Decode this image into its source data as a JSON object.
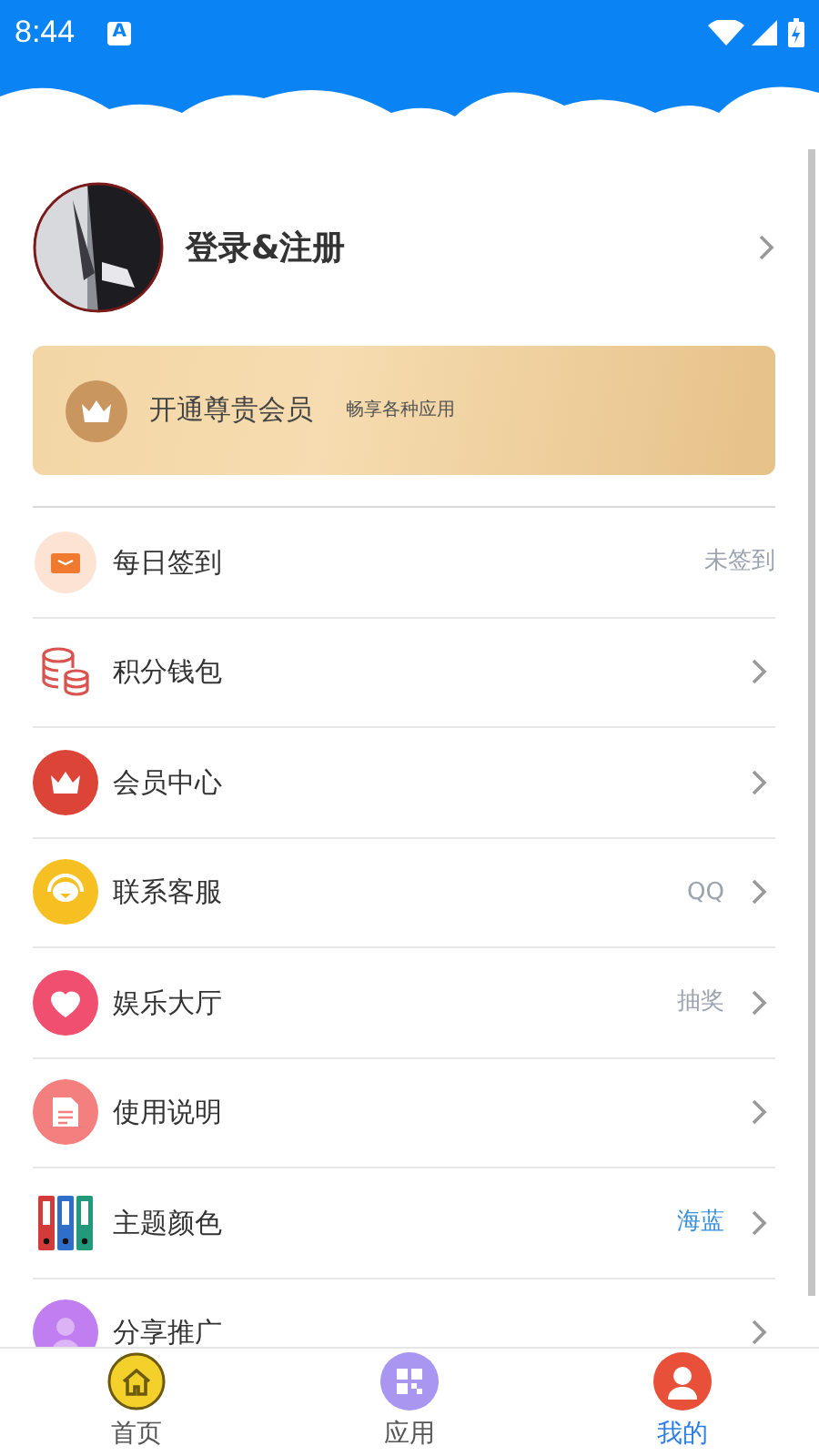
{
  "status_bar": {
    "time": "8:44",
    "notification": "A"
  },
  "profile": {
    "title": "登录&注册"
  },
  "vip_card": {
    "title": "开通尊贵会员",
    "subtitle": "畅享各种应用"
  },
  "menu": [
    {
      "kind": "checkin",
      "label": "每日签到",
      "value": "未签到",
      "highlighted": false,
      "chevron": false
    },
    {
      "kind": "wallet",
      "label": "积分钱包",
      "chevron": true
    },
    {
      "kind": "crown",
      "label": "会员中心",
      "chevron": true
    },
    {
      "kind": "service",
      "label": "联系客服",
      "value": "QQ",
      "highlighted": false,
      "chevron": true
    },
    {
      "kind": "heart",
      "label": "娱乐大厅",
      "value": "抽奖",
      "highlighted": false,
      "chevron": true
    },
    {
      "kind": "doc",
      "label": "使用说明",
      "chevron": true
    },
    {
      "kind": "binders",
      "label": "主题颜色",
      "value": "海蓝",
      "highlighted": true,
      "chevron": true
    },
    {
      "kind": "share",
      "label": "分享推广",
      "chevron": true
    }
  ],
  "tabs": [
    {
      "kind": "home",
      "label": "首页",
      "selected": false
    },
    {
      "kind": "apps",
      "label": "应用",
      "selected": false
    },
    {
      "kind": "me",
      "label": "我的",
      "selected": true
    }
  ]
}
